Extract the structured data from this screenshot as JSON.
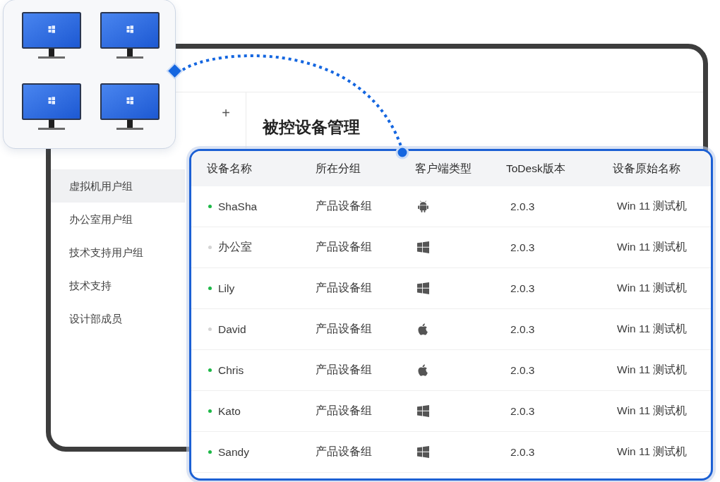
{
  "sidebar": {
    "add_label": "+",
    "items": [
      {
        "label": "虚拟机用户组",
        "selected": true
      },
      {
        "label": "办公室用户组",
        "selected": false
      },
      {
        "label": "技术支持用户组",
        "selected": false
      },
      {
        "label": "技术支持",
        "selected": false
      },
      {
        "label": "设计部成员",
        "selected": false
      }
    ]
  },
  "page": {
    "title": "被控设备管理"
  },
  "table": {
    "columns": [
      "设备名称",
      "所在分组",
      "客户端类型",
      "ToDesk版本",
      "设备原始名称"
    ],
    "rows": [
      {
        "name": "ShaSha",
        "online": true,
        "group": "产品设备组",
        "kind": "android",
        "version": "2.0.3",
        "original_name": "Win 11 测试机"
      },
      {
        "name": "办公室",
        "online": false,
        "group": "产品设备组",
        "kind": "windows",
        "version": "2.0.3",
        "original_name": "Win 11 测试机"
      },
      {
        "name": "Lily",
        "online": true,
        "group": "产品设备组",
        "kind": "windows",
        "version": "2.0.3",
        "original_name": "Win 11 测试机"
      },
      {
        "name": "David",
        "online": false,
        "group": "产品设备组",
        "kind": "apple",
        "version": "2.0.3",
        "original_name": "Win 11 测试机"
      },
      {
        "name": "Chris",
        "online": true,
        "group": "产品设备组",
        "kind": "apple",
        "version": "2.0.3",
        "original_name": "Win 11 测试机"
      },
      {
        "name": "Kato",
        "online": true,
        "group": "产品设备组",
        "kind": "windows",
        "version": "2.0.3",
        "original_name": "Win 11 测试机"
      },
      {
        "name": "Sandy",
        "online": true,
        "group": "产品设备组",
        "kind": "windows",
        "version": "2.0.3",
        "original_name": "Win 11 测试机"
      }
    ]
  }
}
